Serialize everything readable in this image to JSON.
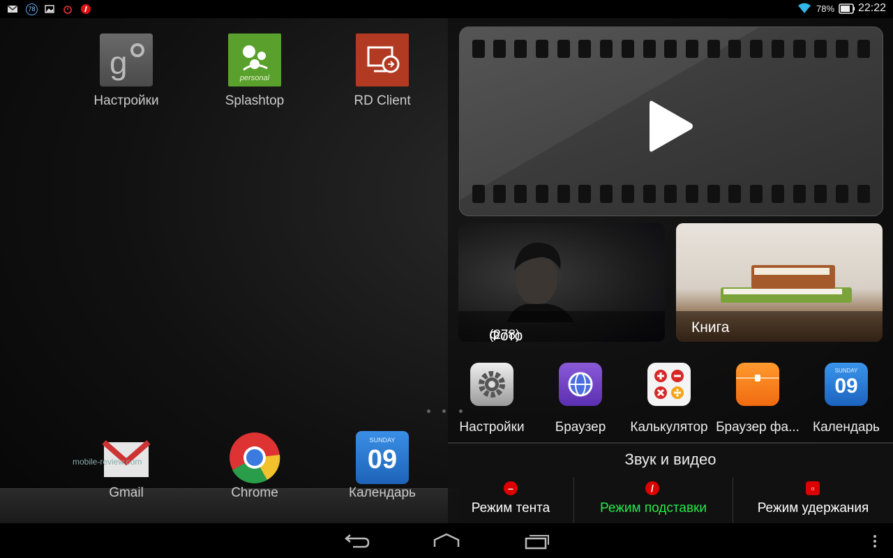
{
  "status_bar": {
    "left_icons": [
      "gmail-icon",
      "badge-78-icon",
      "image-icon",
      "timer-icon",
      "lenovo-icon"
    ],
    "badge_value": "78",
    "battery": "78%",
    "time": "22:22"
  },
  "home_apps": [
    {
      "label": "Настройки"
    },
    {
      "label": "Splashtop",
      "sublabel": "personal"
    },
    {
      "label": "RD Client"
    }
  ],
  "dock_apps": [
    {
      "label": "Gmail"
    },
    {
      "label": "Chrome"
    },
    {
      "label": "Календарь",
      "day": "SUNDAY",
      "date": "09"
    }
  ],
  "watermark": "mobile-review.com",
  "panel": {
    "tiles": [
      {
        "label": "Фото",
        "count": "(278)"
      },
      {
        "label": "Книга"
      }
    ],
    "apps": [
      {
        "label": "Настройки"
      },
      {
        "label": "Браузер"
      },
      {
        "label": "Калькулятор"
      },
      {
        "label": "Браузер фа..."
      },
      {
        "label": "Календарь",
        "day": "SUNDAY",
        "date": "09"
      }
    ],
    "sheet": {
      "title": "Звук и видео",
      "modes": [
        {
          "label": "Режим тента",
          "active": false
        },
        {
          "label": "Режим подставки",
          "active": true
        },
        {
          "label": "Режим удержания",
          "active": false
        }
      ]
    }
  },
  "colors": {
    "active_mode": "#27e84a",
    "accent_red": "#dd1111"
  }
}
